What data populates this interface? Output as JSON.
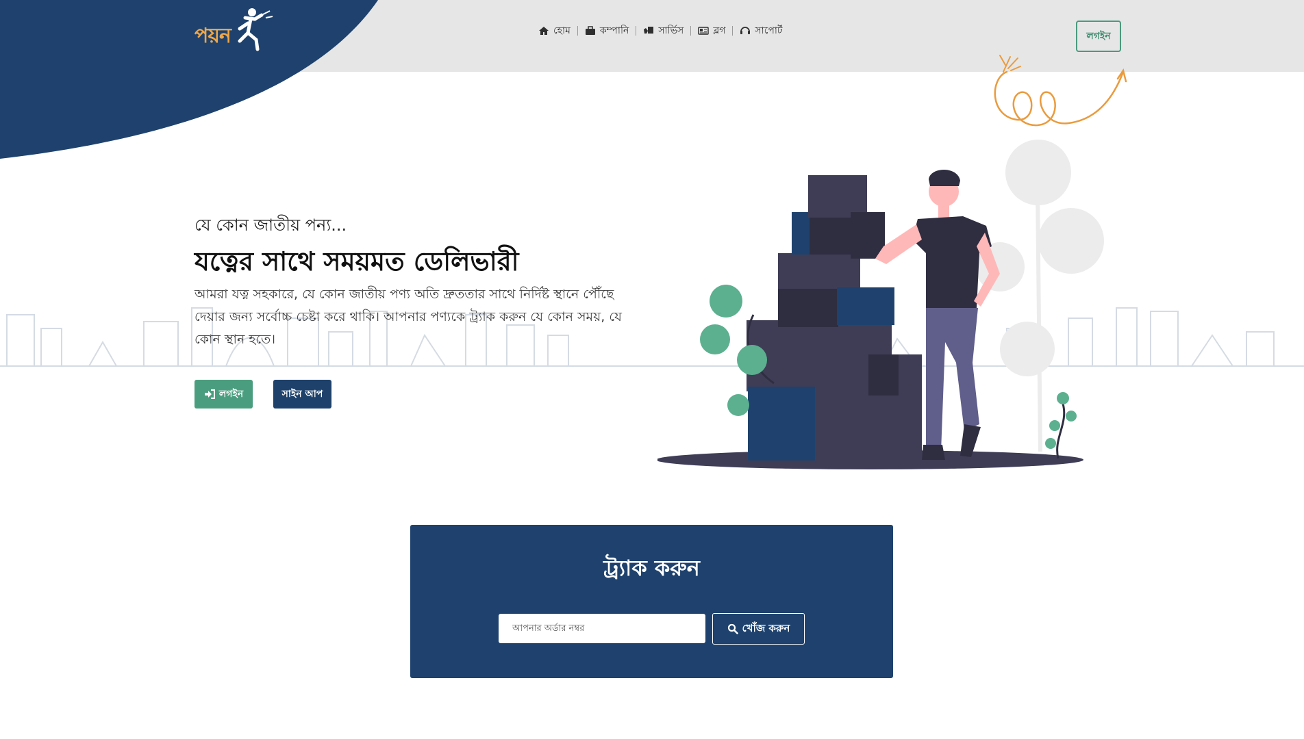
{
  "brand": {
    "logo_text": "পয়ন",
    "accent": "#1e426d",
    "green": "#4a9e7f",
    "orange": "#f0a646"
  },
  "nav": {
    "items": [
      {
        "label": "হোম",
        "icon": "home-icon"
      },
      {
        "label": "কম্পানি",
        "icon": "briefcase-icon"
      },
      {
        "label": "সার্ভিস",
        "icon": "delivery-icon"
      },
      {
        "label": "ব্লগ",
        "icon": "newspaper-icon"
      },
      {
        "label": "সাপোর্ট",
        "icon": "headset-icon"
      }
    ],
    "login_label": "লগইন"
  },
  "hero": {
    "kicker": "যে কোন জাতীয় পন্য...",
    "title": "যত্নের সাথে সময়মত ডেলিভারী",
    "description": "আমরা যত্ন সহকারে, যে কোন জাতীয় পণ্য অতি দ্রুততার সাথে নির্দিষ্ট স্থানে পৌঁছে দেয়ার জন্য সর্বোচ্চ চেষ্টা করে থাকি। আপনার পণ্যকে ট্র্যাক করুন যে কোন সময়, যে কোন স্থান হতে।",
    "login_button": "লগইন",
    "signup_button": "সাইন আপ"
  },
  "track": {
    "title": "ট্র্যাক করুন",
    "input_placeholder": "আপনার অর্ডার নম্বর",
    "search_button": "খোঁজ করুন"
  }
}
